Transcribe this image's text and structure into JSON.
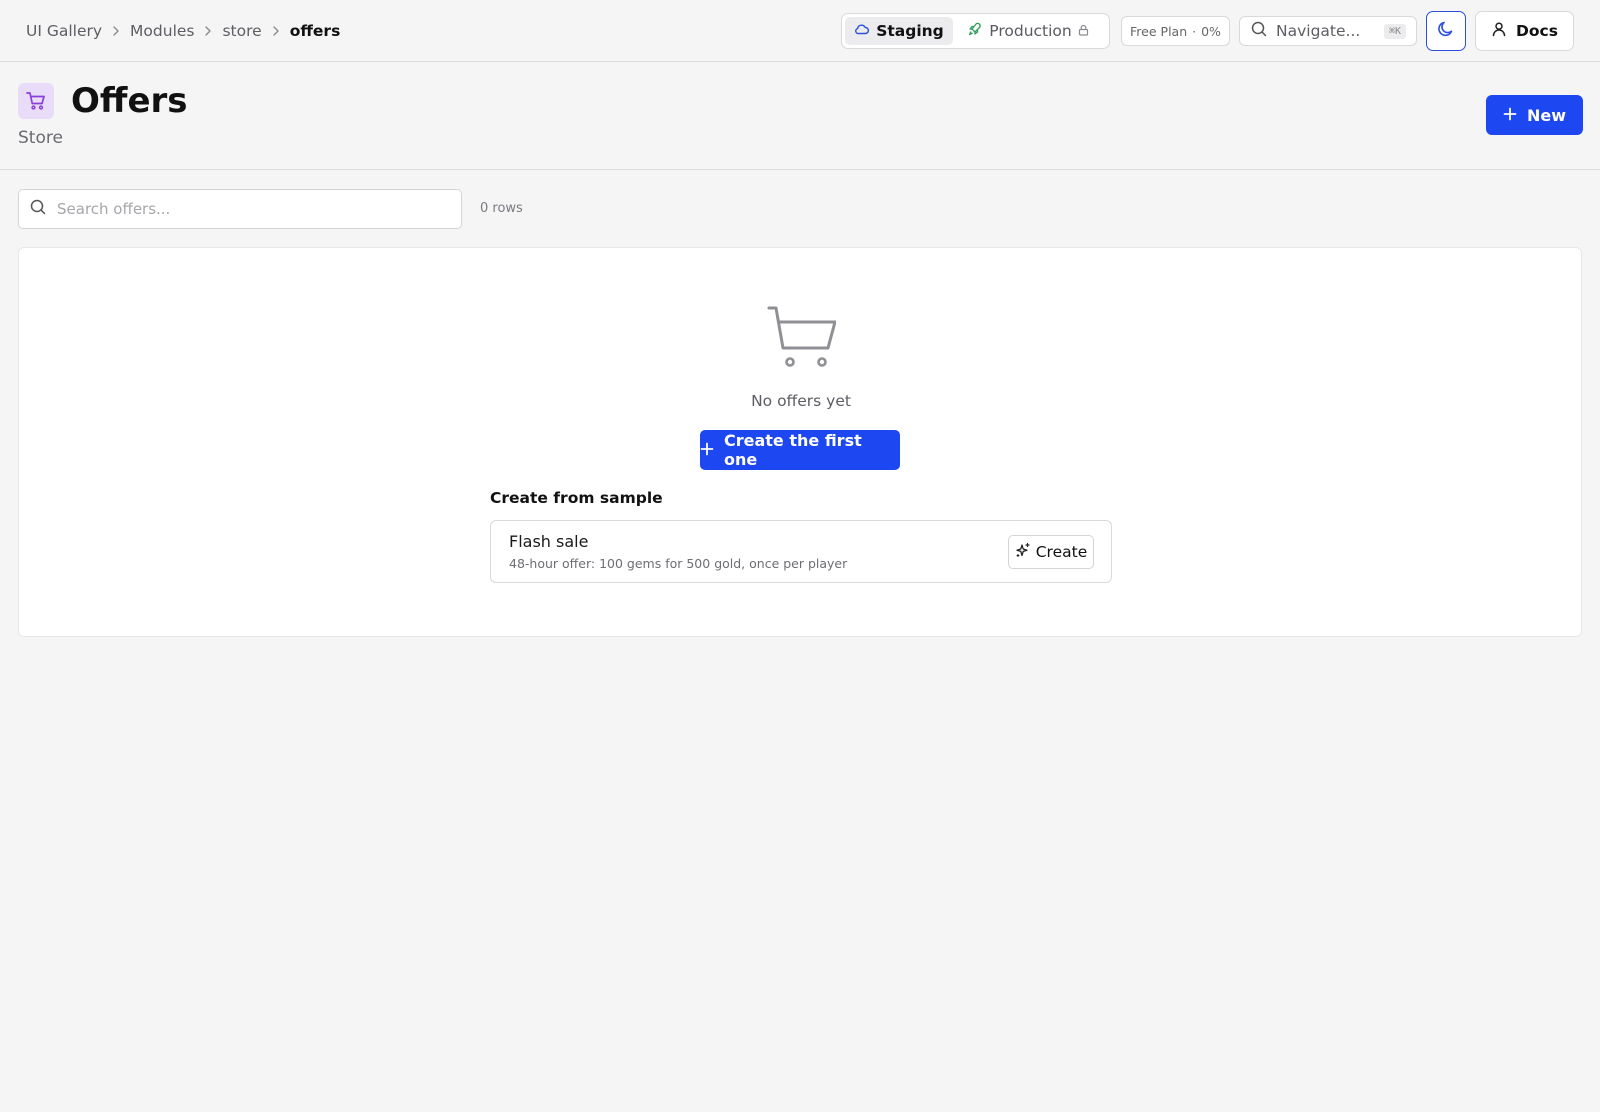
{
  "breadcrumb": {
    "items": [
      "UI Gallery",
      "Modules",
      "store"
    ],
    "current": "offers"
  },
  "environments": {
    "staging": "Staging",
    "production": "Production"
  },
  "plan": {
    "name": "Free Plan",
    "separator": "·",
    "usage": "0%"
  },
  "nav_search": {
    "label": "Navigate...",
    "shortcut": "⌘K"
  },
  "docs": {
    "label": "Docs"
  },
  "header": {
    "title": "Offers",
    "subtitle": "Store",
    "new_label": "New"
  },
  "search": {
    "placeholder": "Search offers...",
    "value": "",
    "row_count": "0 rows"
  },
  "empty_state": {
    "message": "No offers yet",
    "button_label": "Create the first one"
  },
  "samples": {
    "heading": "Create from sample",
    "items": [
      {
        "name": "Flash sale",
        "description": "48-hour offer: 100 gems for 500 gold, once per player",
        "button_label": "Create"
      }
    ]
  },
  "colors": {
    "accent": "#1d47f0",
    "page_bg": "#f5f5f6",
    "icon_bg": "#e8dcf8",
    "icon_purple": "#8b3fd9",
    "production_green": "#2f9e5a"
  },
  "icons": {
    "staging": "cloud-icon",
    "production": "rocket-icon",
    "production_lock": "lock-icon",
    "nav_search": "search-icon",
    "theme": "moon-icon",
    "docs": "user-icon",
    "header": "cart-icon",
    "new": "plus-icon",
    "empty": "cart-icon",
    "sample_create": "sparkles-icon"
  }
}
